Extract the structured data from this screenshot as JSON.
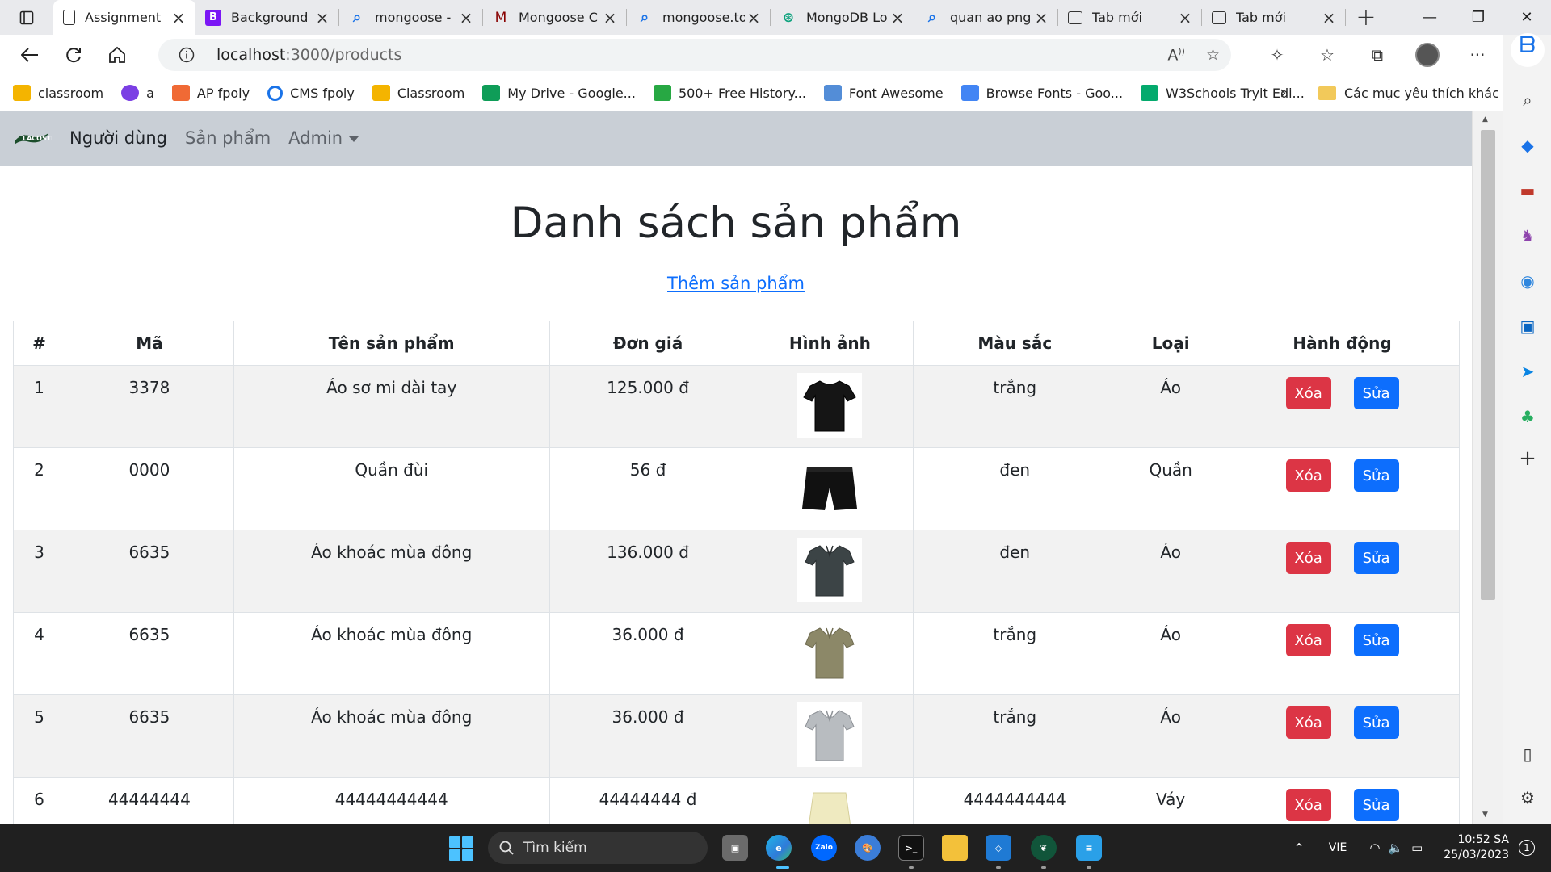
{
  "browser": {
    "tabs": [
      {
        "title": "Assignment",
        "icon": "page-icon",
        "favicon_color": "#ffffff",
        "active": true
      },
      {
        "title": "Background",
        "icon": "bootstrap-icon",
        "favicon_color": "#7b16f5",
        "active": false
      },
      {
        "title": "mongoose -",
        "icon": "search-icon",
        "favicon_color": "#e9eaed",
        "active": false
      },
      {
        "title": "Mongoose C",
        "icon": "mongoose-icon",
        "favicon_color": "#e9eaed",
        "active": false
      },
      {
        "title": "mongoose.to",
        "icon": "search-icon",
        "favicon_color": "#e9eaed",
        "active": false
      },
      {
        "title": "MongoDB Lo",
        "icon": "chatgpt-icon",
        "favicon_color": "#e9eaed",
        "active": false
      },
      {
        "title": "quan ao png",
        "icon": "search-icon",
        "favicon_color": "#e9eaed",
        "active": false
      },
      {
        "title": "Tab mới",
        "icon": "newtab-icon",
        "favicon_color": "#e9eaed",
        "active": false
      },
      {
        "title": "Tab mới",
        "icon": "newtab-icon",
        "favicon_color": "#e9eaed",
        "active": false
      }
    ],
    "address": {
      "host": "localhost",
      "path": ":3000/products"
    },
    "bookmarks": [
      {
        "label": "classroom",
        "icon": "classroom-icon",
        "color": "#f4b400"
      },
      {
        "label": "a",
        "icon": "circle-icon",
        "color": "#7b3fe4"
      },
      {
        "label": "AP fpoly",
        "icon": "ap-icon",
        "color": "#f06a35"
      },
      {
        "label": "CMS fpoly",
        "icon": "ring-icon",
        "color": "#1a73e8"
      },
      {
        "label": "Classroom",
        "icon": "classroom-icon",
        "color": "#f4b400"
      },
      {
        "label": "My Drive - Google...",
        "icon": "drive-icon",
        "color": "#0f9d58"
      },
      {
        "label": "500+ Free History...",
        "icon": "px-icon",
        "color": "#27a843"
      },
      {
        "label": "Font Awesome",
        "icon": "flag-icon",
        "color": "#538dd7"
      },
      {
        "label": "Browse Fonts - Goo...",
        "icon": "fonts-icon",
        "color": "#4285f4"
      },
      {
        "label": "W3Schools Tryit Edi...",
        "icon": "w3-icon",
        "color": "#04aa6d"
      }
    ],
    "bookmarks_folder": "Các mục yêu thích khác"
  },
  "app": {
    "nav": {
      "users": "Người dùng",
      "products": "Sản phẩm",
      "admin": "Admin"
    },
    "title": "Danh sách sản phẩm",
    "add_link": "Thêm sản phẩm",
    "table": {
      "headers": [
        "#",
        "Mã",
        "Tên sản phẩm",
        "Đơn giá",
        "Hình ảnh",
        "Màu sắc",
        "Loại",
        "Hành động"
      ],
      "rows": [
        {
          "no": "1",
          "code": "3378",
          "name": "Áo sơ mi dài tay",
          "price": "125.000 đ",
          "image": "black-tshirt",
          "color": "trắng",
          "type": "Áo"
        },
        {
          "no": "2",
          "code": "0000",
          "name": "Quần đùi",
          "price": "56 đ",
          "image": "black-shorts",
          "color": "đen",
          "type": "Quần"
        },
        {
          "no": "3",
          "code": "6635",
          "name": "Áo khoác mùa đông",
          "price": "136.000 đ",
          "image": "dark-polo",
          "color": "đen",
          "type": "Áo"
        },
        {
          "no": "4",
          "code": "6635",
          "name": "Áo khoác mùa đông",
          "price": "36.000 đ",
          "image": "khaki-polo",
          "color": "trắng",
          "type": "Áo"
        },
        {
          "no": "5",
          "code": "6635",
          "name": "Áo khoác mùa đông",
          "price": "36.000 đ",
          "image": "grey-polo",
          "color": "trắng",
          "type": "Áo"
        },
        {
          "no": "6",
          "code": "44444444",
          "name": "44444444444",
          "price": "44444444 đ",
          "image": "cream-skirt",
          "color": "4444444444",
          "type": "Váy"
        }
      ],
      "delete_label": "Xóa",
      "edit_label": "Sửa"
    }
  },
  "taskbar": {
    "search_placeholder": "Tìm kiếm",
    "language": "VIE",
    "time": "10:52 SA",
    "date": "25/03/2023",
    "notification_count": "1"
  }
}
